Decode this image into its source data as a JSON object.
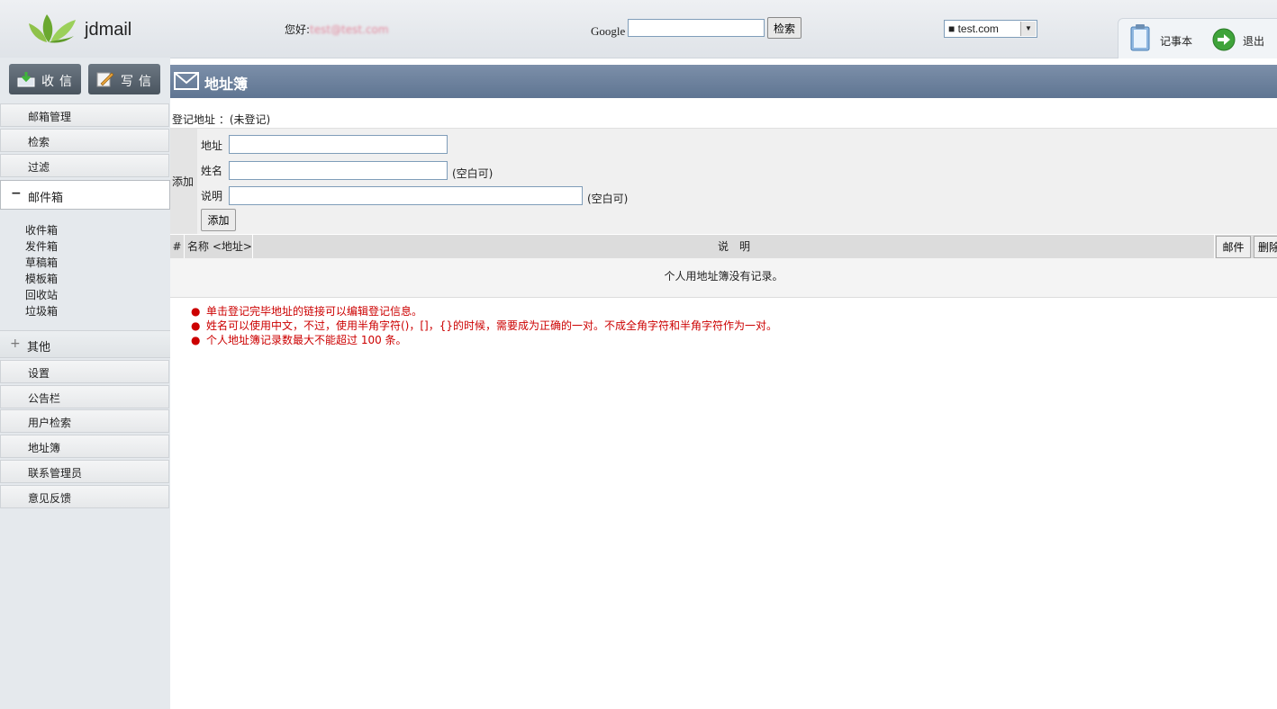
{
  "header": {
    "logo_text": "jdmail",
    "greeting": "您好:",
    "user_email": "test@test.com",
    "google_label": "Google",
    "google_query": "",
    "search_button": "检索",
    "domain_selected": "■ test.com",
    "notepad_label": "记事本",
    "logout_label": "退出"
  },
  "sidebar": {
    "receive_label": "收信",
    "compose_label": "写信",
    "items_top": [
      "邮箱管理",
      "检索",
      "过滤"
    ],
    "mailbox_sign": "−",
    "mailbox_label": "邮件箱",
    "folders": [
      "收件箱",
      "发件箱",
      "草稿箱",
      "模板箱",
      "回收站",
      "垃圾箱"
    ],
    "other_sign": "+",
    "other_label": "其他",
    "items_bottom": [
      "设置",
      "公告栏",
      "用户检索",
      "地址簿",
      "联系管理员",
      "意见反馈"
    ]
  },
  "main": {
    "title": "地址簿",
    "registered_label": "登记地址 ：(未登记)",
    "add_side_label": "添加",
    "form": {
      "address_label": "地址",
      "address_value": "",
      "name_label": "姓名",
      "name_value": "",
      "name_note": "(空白可)",
      "desc_label": "说明",
      "desc_value": "",
      "desc_note": "(空白可)",
      "submit_label": "添加"
    },
    "table": {
      "col_num": "#",
      "col_name": "名称 <地址>",
      "col_desc": "说　明",
      "mail_button": "邮件",
      "delete_button": "删除",
      "empty_message": "个人用地址簿没有记录。"
    },
    "notes": [
      "单击登记完毕地址的链接可以编辑登记信息。",
      "姓名可以使用中文，不过，使用半角字符()，[]，{}的时候，需要成为正确的一对。不成全角字符和半角字符作为一对。",
      "个人地址簿记录数最大不能超过 100 条。"
    ],
    "notes_color": "#cc0000"
  }
}
